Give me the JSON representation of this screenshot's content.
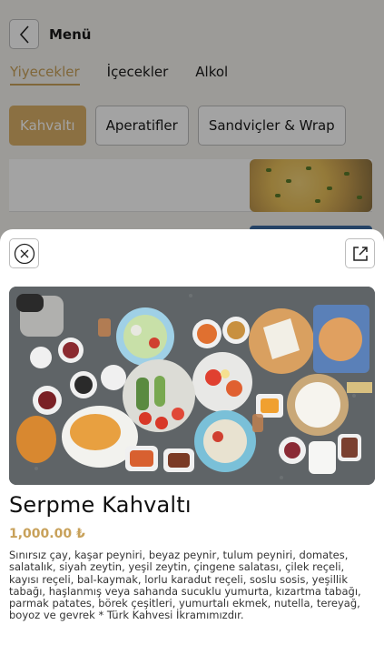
{
  "header": {
    "back_icon": "chevron-left-icon",
    "title": "Menü"
  },
  "tabs": [
    {
      "label": "Yiyecekler",
      "active": true
    },
    {
      "label": "İçecekler",
      "active": false
    },
    {
      "label": "Alkol",
      "active": false
    }
  ],
  "categories": [
    {
      "label": "Kahvaltı",
      "active": true
    },
    {
      "label": "Aperatifler",
      "active": false
    },
    {
      "label": "Sandviçler & Wrap",
      "active": false
    }
  ],
  "modal": {
    "close_icon": "close-circle-icon",
    "share_icon": "share-icon",
    "product": {
      "name": "Serpme Kahvaltı",
      "price": "1,000.00 ₺",
      "description": "Sınırsız çay, kaşar peyniri, beyaz peynir, tulum peyniri, domates, salatalık, siyah zeytin, yeşil zeytin, çingene salatası, çilek reçeli, kayısı reçeli, bal-kaymak, lorlu karadut reçeli, soslu sosis, yeşillik tabağı, haşlanmış veya sahanda sucuklu yumurta, kızartma tabağı, parmak patates, börek çeşitleri, yumurtalı ekmek, nutella, tereyağ, boyoz ve gevrek * Türk Kahvesi İkramımızdır."
    }
  },
  "colors": {
    "accent": "#c8a15a",
    "overlay": "rgba(0,0,0,0.36)"
  }
}
